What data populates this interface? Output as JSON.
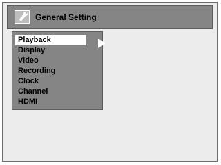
{
  "header": {
    "title": "General Setting",
    "icon": "wrench-icon"
  },
  "menu": {
    "items": [
      {
        "label": "Playback",
        "selected": true
      },
      {
        "label": "Display",
        "selected": false
      },
      {
        "label": "Video",
        "selected": false
      },
      {
        "label": "Recording",
        "selected": false
      },
      {
        "label": "Clock",
        "selected": false
      },
      {
        "label": "Channel",
        "selected": false
      },
      {
        "label": "HDMI",
        "selected": false
      }
    ],
    "submenu_indicator": "right-arrow-icon"
  },
  "colors": {
    "panel": "#858585",
    "background": "#ececec",
    "highlight": "#ffffff"
  }
}
